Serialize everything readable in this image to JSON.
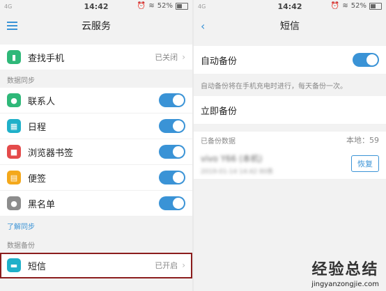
{
  "left": {
    "status": {
      "carrier": "4G",
      "time": "14:42",
      "battery": "52%"
    },
    "nav": {
      "title": "云服务"
    },
    "find_phone": {
      "label": "查找手机",
      "value": "已关闭"
    },
    "sync": {
      "section_title": "数据同步",
      "items": [
        {
          "label": "联系人",
          "icon": "contacts-icon",
          "color": "#2fb879"
        },
        {
          "label": "日程",
          "icon": "calendar-icon",
          "color": "#1fb0c9"
        },
        {
          "label": "浏览器书签",
          "icon": "bookmark-icon",
          "color": "#e44b4b"
        },
        {
          "label": "便签",
          "icon": "notes-icon",
          "color": "#f4a81b"
        },
        {
          "label": "黑名单",
          "icon": "blacklist-icon",
          "color": "#8d8d8d"
        }
      ],
      "learn_more": "了解同步"
    },
    "backup": {
      "section_title": "数据备份",
      "sms": {
        "label": "短信",
        "value": "已开启"
      }
    }
  },
  "right": {
    "status": {
      "carrier": "4G",
      "time": "14:42",
      "battery": "52%"
    },
    "nav": {
      "title": "短信"
    },
    "auto_backup": {
      "label": "自动备份",
      "desc": "自动备份将在手机充电时进行，每天备份一次。"
    },
    "backup_now": {
      "label": "立即备份"
    },
    "backed_up": {
      "section_title": "已备份数据",
      "local_count": "本地：59",
      "entry_title": "vivo Y66 (本机)",
      "entry_subtitle": "2019-01-14 14:42 80条",
      "restore_label": "恢复"
    }
  },
  "watermark": {
    "main": "经验总结",
    "sub": "jingyanzongjie.com"
  },
  "colors": {
    "accent": "#3a93d6",
    "highlight_border": "#8b1d1d"
  }
}
